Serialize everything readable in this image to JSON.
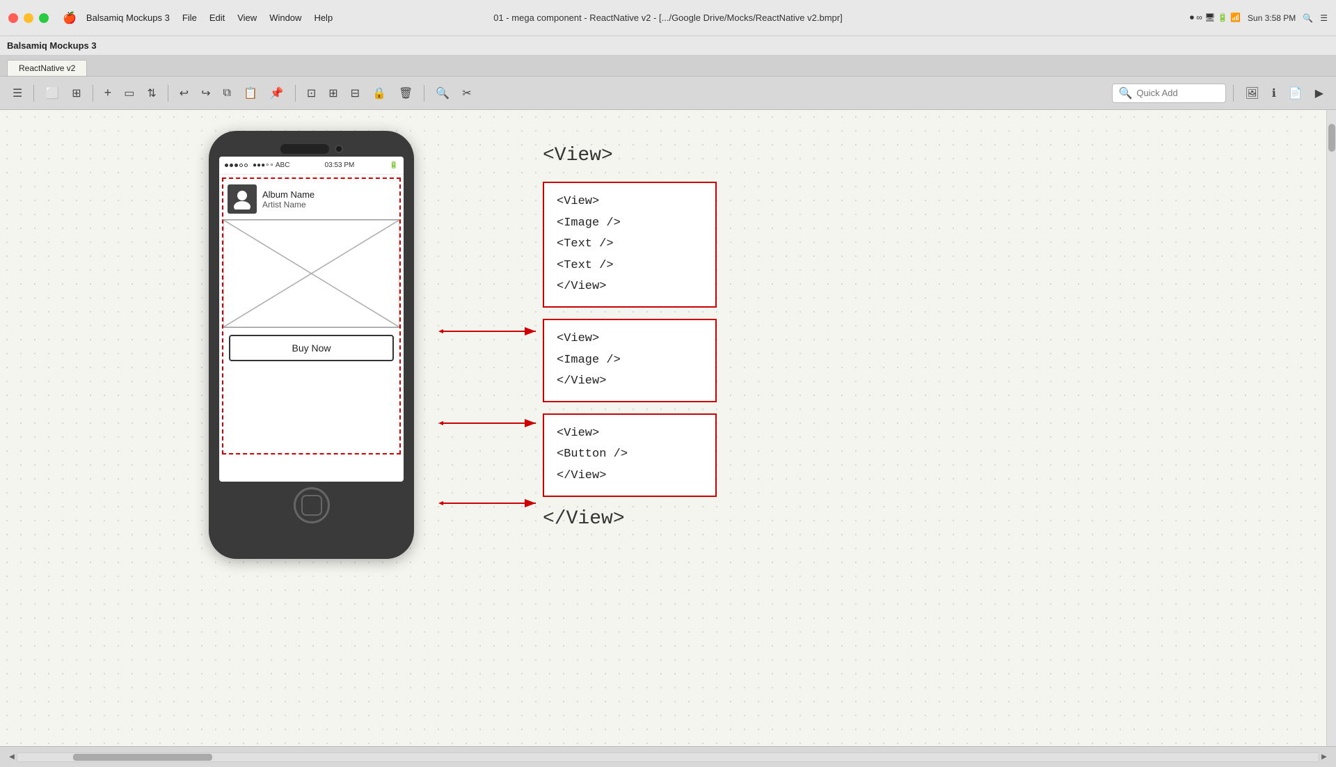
{
  "titlebar": {
    "title": "01 - mega component - ReactNative v2 - [.../Google Drive/Mocks/ReactNative v2.bmpr]",
    "app_name": "Balsamiq Mockups 3"
  },
  "menubar": {
    "apple": "🍎",
    "items": [
      "Balsamiq Mockups 3",
      "File",
      "Edit",
      "View",
      "Window",
      "Help"
    ]
  },
  "app_tab": {
    "name": "ReactNative v2"
  },
  "toolbar": {
    "quick_add_placeholder": "Quick Add",
    "quick_add_label": "Quick Add"
  },
  "canvas": {
    "phone": {
      "status": {
        "dots": "●●●∘∘ ABC",
        "time": "03:53 PM",
        "battery": "▓"
      },
      "album_name": "Album Name",
      "artist_name": "Artist Name",
      "buy_now": "Buy Now"
    },
    "annotations": {
      "view_open": "<View>",
      "view_close": "</View>",
      "box1": {
        "line1": "<View>",
        "line2": "    <Image />",
        "line3": "    <Text />",
        "line4": "    <Text />",
        "line5": "</View>"
      },
      "box2": {
        "line1": "<View>",
        "line2": "    <Image />",
        "line3": "</View>"
      },
      "box3": {
        "line1": "<View>",
        "line2": "    <Button />",
        "line3": "</View>"
      }
    }
  },
  "status_bar": {
    "time": "Sun 3:58 PM"
  }
}
